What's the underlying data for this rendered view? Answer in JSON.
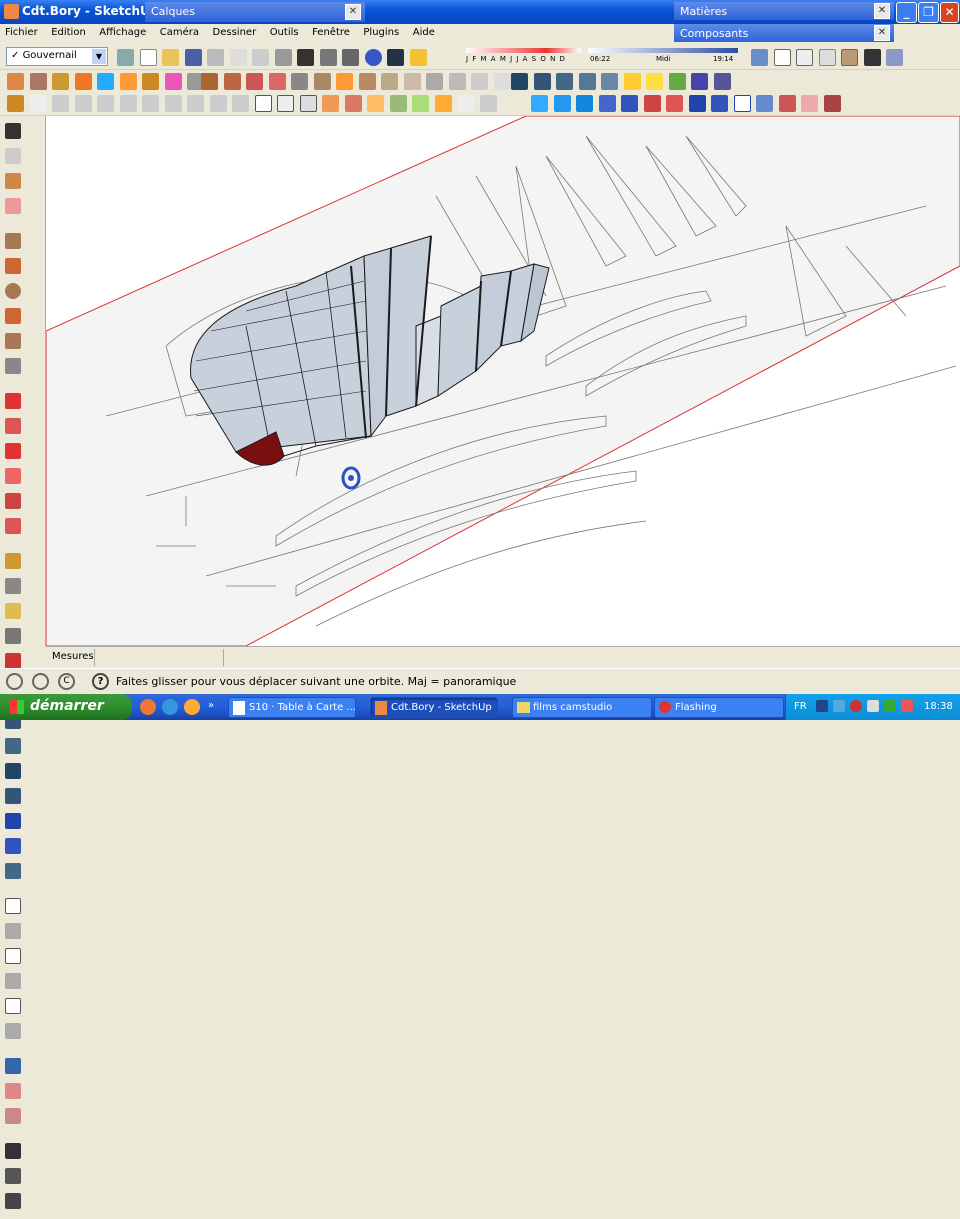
{
  "window": {
    "title": "Cdt.Bory - SketchUp"
  },
  "panels": {
    "layers": "Calques",
    "materials": "Matières",
    "components": "Composants"
  },
  "menu": [
    "Fichier",
    "Edition",
    "Affichage",
    "Caméra",
    "Dessiner",
    "Outils",
    "Fenêtre",
    "Plugins",
    "Aide"
  ],
  "layer_select": {
    "value": "Gouvernail"
  },
  "shadow": {
    "months": "J F M A M J J A S O N D",
    "time_start": "06:22",
    "time_mid": "Midi",
    "time_end": "19:14"
  },
  "measure": {
    "label": "Mesures",
    "value": ""
  },
  "status": {
    "hint": "Faites glisser pour vous déplacer suivant une orbite.  Maj = panoramique"
  },
  "taskbar": {
    "start": "démarrer",
    "tasks": [
      "S10 · Table à Carte ...",
      "Cdt.Bory - SketchUp",
      "films camstudio",
      "Flashing"
    ],
    "lang": "FR",
    "clock": "18:38"
  },
  "colors": {
    "accent": "#245edb",
    "start": "#2f8f2f",
    "hull": "#c8d0dc",
    "rudder": "#7a0f0f"
  }
}
